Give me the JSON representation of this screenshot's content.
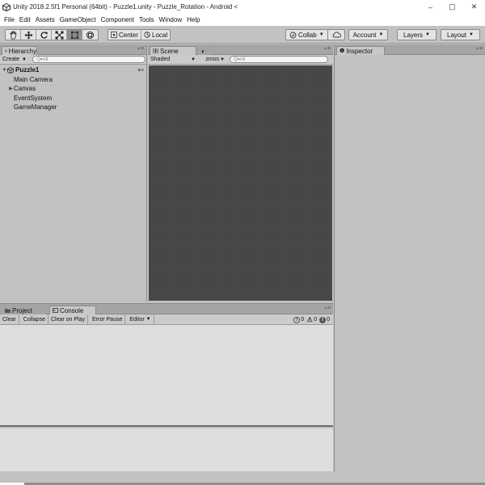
{
  "window": {
    "title": "Unity 2018.2.5f1 Personal (64bit) - Puzzle1.unity - Puzzle_Rotation - Android <",
    "minimize_glyph": "–",
    "maximize_glyph": "▢",
    "close_glyph": "✕"
  },
  "menu": [
    "File",
    "Edit",
    "Assets",
    "GameObject",
    "Component",
    "Tools",
    "Window",
    "Help"
  ],
  "toolbar": {
    "tools": [
      "hand-tool-icon",
      "move-tool-icon",
      "rotate-tool-icon",
      "scale-tool-icon",
      "rect-tool-icon",
      "transform-tool-icon"
    ],
    "active_tool": "rect-tool-icon",
    "pivot_mode": "Center",
    "pivot_rotation": "Local",
    "collab": "Collab",
    "account": "Account",
    "layers": "Layers",
    "layout": "Layout"
  },
  "hierarchy": {
    "tab": "Hierarchy",
    "create": "Create",
    "search_placeholder": "Q▾All",
    "scene_name": "Puzzle1",
    "items": [
      {
        "label": "Main Camera",
        "has_children": false
      },
      {
        "label": "Canvas",
        "has_children": true
      },
      {
        "label": "EventSystem",
        "has_children": false
      },
      {
        "label": "GameManager",
        "has_children": false
      }
    ]
  },
  "scene": {
    "tab": "Scene",
    "second_tab_icon": "game-view-icon",
    "shading_mode": "Shaded",
    "gizmos": "Gizmos",
    "search_placeholder": "Q▾All",
    "background_color": "#474747"
  },
  "project_console": {
    "project_tab": "Project",
    "console_tab": "Console",
    "buttons": [
      "Clear",
      "Collapse",
      "Clear on Play",
      "Error Pause",
      "Editor"
    ],
    "log_count": "0",
    "warning_count": "0",
    "error_count": "0"
  },
  "inspector": {
    "tab": "Inspector"
  }
}
